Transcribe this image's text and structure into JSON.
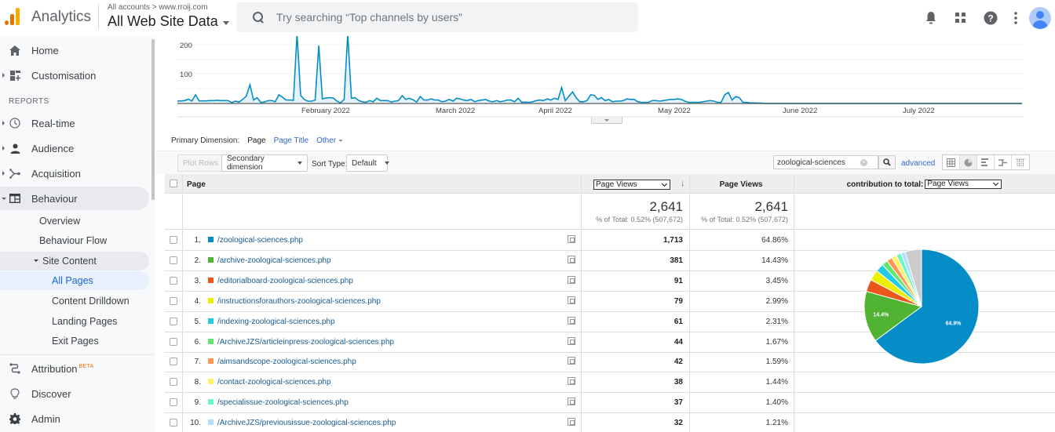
{
  "header": {
    "app_title": "Analytics",
    "breadcrumb": "All accounts > www.rroij.com",
    "property": "All Web Site Data",
    "search_placeholder": "Try searching “Top channels by users”",
    "icons": [
      "bell-icon",
      "apps-grid-icon",
      "help-icon",
      "more-vert-icon",
      "account-avatar"
    ]
  },
  "sidebar": {
    "top_items": [
      {
        "label": "Home",
        "icon": "home-icon"
      },
      {
        "label": "Customisation",
        "icon": "dashboard-icon"
      }
    ],
    "section_label": "REPORTS",
    "report_items": [
      {
        "label": "Real-time",
        "icon": "clock-icon"
      },
      {
        "label": "Audience",
        "icon": "person-icon"
      },
      {
        "label": "Acquisition",
        "icon": "acquisition-icon"
      },
      {
        "label": "Behaviour",
        "icon": "behaviour-icon"
      }
    ],
    "behaviour_sub": [
      "Overview",
      "Behaviour Flow",
      "Site Content"
    ],
    "site_content_sub": [
      "All Pages",
      "Content Drilldown",
      "Landing Pages",
      "Exit Pages"
    ],
    "selected": "All Pages",
    "bottom_items": [
      {
        "label": "Attribution",
        "badge": "BETA",
        "icon": "attribution-icon"
      },
      {
        "label": "Discover",
        "icon": "lightbulb-icon"
      },
      {
        "label": "Admin",
        "icon": "gear-icon"
      }
    ]
  },
  "timeline": {
    "y_ticks": [
      "100",
      "200"
    ],
    "x_labels": [
      "February 2022",
      "March 2022",
      "April 2022",
      "May 2022",
      "June 2022",
      "July 2022"
    ],
    "series_name": "Page Views",
    "color": "#058dc7"
  },
  "dimension": {
    "label": "Primary Dimension:",
    "current": "Page",
    "options": [
      "Page Title",
      "Other"
    ]
  },
  "toolbar": {
    "plot_rows": "Plot Rows",
    "secondary_dimension": "Secondary dimension",
    "sort_type_label": "Sort Type:",
    "sort_type_value": "Default",
    "filter_value": "zoological-sciences",
    "advanced": "advanced"
  },
  "table": {
    "col_page": "Page",
    "col_metric_select": "Page Views",
    "col_metric2": "Page Views",
    "contribution_label": "contribution to total:",
    "contribution_select": "Page Views",
    "totals": {
      "value1": "2,641",
      "pct1": "% of Total: 0.52% (507,672)",
      "value2": "2,641",
      "pct2": "% of Total: 0.52% (507,672)"
    },
    "rows": [
      {
        "idx": "1.",
        "page": "/zoological-sciences.php",
        "views": "1,713",
        "pct": "64.86%",
        "color": "#058dc7"
      },
      {
        "idx": "2.",
        "page": "/archive-zoological-sciences.php",
        "views": "381",
        "pct": "14.43%",
        "color": "#50b432"
      },
      {
        "idx": "3.",
        "page": "/editorialboard-zoological-sciences.php",
        "views": "91",
        "pct": "3.45%",
        "color": "#ed561b"
      },
      {
        "idx": "4.",
        "page": "/instructionsforauthors-zoological-sciences.php",
        "views": "79",
        "pct": "2.99%",
        "color": "#edef00"
      },
      {
        "idx": "5.",
        "page": "/indexing-zoological-sciences.php",
        "views": "61",
        "pct": "2.31%",
        "color": "#24cbe5"
      },
      {
        "idx": "6.",
        "page": "/ArchiveJZS/articleinpress-zoological-sciences.php",
        "views": "44",
        "pct": "1.67%",
        "color": "#64e572"
      },
      {
        "idx": "7.",
        "page": "/aimsandscope-zoological-sciences.php",
        "views": "42",
        "pct": "1.59%",
        "color": "#ff9655"
      },
      {
        "idx": "8.",
        "page": "/contact-zoological-sciences.php",
        "views": "38",
        "pct": "1.44%",
        "color": "#fff263"
      },
      {
        "idx": "9.",
        "page": "/specialissue-zoological-sciences.php",
        "views": "37",
        "pct": "1.40%",
        "color": "#6af9c4"
      },
      {
        "idx": "10.",
        "page": "/ArchiveJZS/previousissue-zoological-sciences.php",
        "views": "32",
        "pct": "1.21%",
        "color": "#b2deff"
      }
    ]
  },
  "pie": {
    "labels_shown": [
      "64.9%",
      "14.4%"
    ],
    "slices": [
      {
        "name": "/zoological-sciences.php",
        "value": 1713,
        "color": "#058dc7"
      },
      {
        "name": "/archive-zoological-sciences.php",
        "value": 381,
        "color": "#50b432"
      },
      {
        "name": "/editorialboard-zoological-sciences.php",
        "value": 91,
        "color": "#ed561b"
      },
      {
        "name": "/instructionsforauthors-zoological-sciences.php",
        "value": 79,
        "color": "#edef00"
      },
      {
        "name": "/indexing-zoological-sciences.php",
        "value": 61,
        "color": "#24cbe5"
      },
      {
        "name": "/ArchiveJZS/articleinpress-zoological-sciences.php",
        "value": 44,
        "color": "#64e572"
      },
      {
        "name": "/aimsandscope-zoological-sciences.php",
        "value": 42,
        "color": "#ff9655"
      },
      {
        "name": "/contact-zoological-sciences.php",
        "value": 38,
        "color": "#fff263"
      },
      {
        "name": "/specialissue-zoological-sciences.php",
        "value": 37,
        "color": "#6af9c4"
      },
      {
        "name": "/ArchiveJZS/previousissue-zoological-sciences.php",
        "value": 32,
        "color": "#b2deff"
      },
      {
        "name": "Other",
        "value": 123,
        "color": "#cccccc"
      }
    ]
  }
}
